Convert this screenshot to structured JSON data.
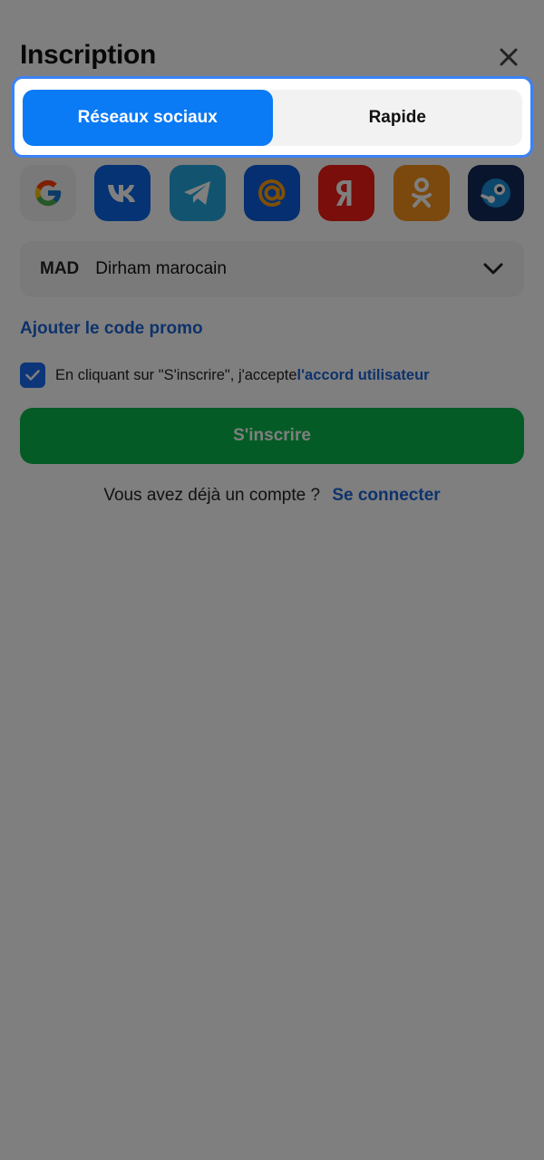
{
  "header": {
    "title": "Inscription"
  },
  "tabs": [
    {
      "label": "Réseaux sociaux",
      "active": true
    },
    {
      "label": "Rapide",
      "active": false
    }
  ],
  "social_buttons": [
    {
      "name": "google",
      "icon": "google-icon",
      "color": "#f2f2f2"
    },
    {
      "name": "vk",
      "icon": "vk-icon",
      "color": "#0a66e8"
    },
    {
      "name": "telegram",
      "icon": "telegram-icon",
      "color": "#24a8df"
    },
    {
      "name": "mail",
      "icon": "at-icon",
      "color": "#0a5fe0"
    },
    {
      "name": "yandex",
      "icon": "yandex-icon",
      "color": "#f31d16"
    },
    {
      "name": "odnoklassniki",
      "icon": "ok-icon",
      "color": "#f7931a"
    },
    {
      "name": "steam",
      "icon": "steam-icon",
      "color": "#122a59"
    }
  ],
  "currency": {
    "code": "MAD",
    "name": "Dirham marocain"
  },
  "promo": {
    "label": "Ajouter le code promo"
  },
  "terms": {
    "checked": true,
    "text": "En cliquant sur \"S'inscrire\", j'accepte ",
    "link": "l'accord utilisateur"
  },
  "signup_button": {
    "label": "S'inscrire"
  },
  "login": {
    "question": "Vous avez déjà un compte ?",
    "link": "Se connecter"
  },
  "colors": {
    "accent": "#0a7af5",
    "link": "#1c64d6",
    "signup": "#09b64a",
    "highlight": "#3b82f6"
  }
}
